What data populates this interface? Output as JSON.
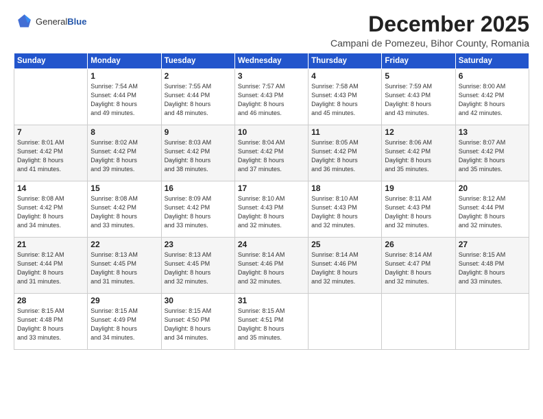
{
  "logo": {
    "general": "General",
    "blue": "Blue"
  },
  "header": {
    "month": "December 2025",
    "location": "Campani de Pomezeu, Bihor County, Romania"
  },
  "weekdays": [
    "Sunday",
    "Monday",
    "Tuesday",
    "Wednesday",
    "Thursday",
    "Friday",
    "Saturday"
  ],
  "weeks": [
    [
      {
        "day": "",
        "info": ""
      },
      {
        "day": "1",
        "info": "Sunrise: 7:54 AM\nSunset: 4:44 PM\nDaylight: 8 hours\nand 49 minutes."
      },
      {
        "day": "2",
        "info": "Sunrise: 7:55 AM\nSunset: 4:44 PM\nDaylight: 8 hours\nand 48 minutes."
      },
      {
        "day": "3",
        "info": "Sunrise: 7:57 AM\nSunset: 4:43 PM\nDaylight: 8 hours\nand 46 minutes."
      },
      {
        "day": "4",
        "info": "Sunrise: 7:58 AM\nSunset: 4:43 PM\nDaylight: 8 hours\nand 45 minutes."
      },
      {
        "day": "5",
        "info": "Sunrise: 7:59 AM\nSunset: 4:43 PM\nDaylight: 8 hours\nand 43 minutes."
      },
      {
        "day": "6",
        "info": "Sunrise: 8:00 AM\nSunset: 4:42 PM\nDaylight: 8 hours\nand 42 minutes."
      }
    ],
    [
      {
        "day": "7",
        "info": "Sunrise: 8:01 AM\nSunset: 4:42 PM\nDaylight: 8 hours\nand 41 minutes."
      },
      {
        "day": "8",
        "info": "Sunrise: 8:02 AM\nSunset: 4:42 PM\nDaylight: 8 hours\nand 39 minutes."
      },
      {
        "day": "9",
        "info": "Sunrise: 8:03 AM\nSunset: 4:42 PM\nDaylight: 8 hours\nand 38 minutes."
      },
      {
        "day": "10",
        "info": "Sunrise: 8:04 AM\nSunset: 4:42 PM\nDaylight: 8 hours\nand 37 minutes."
      },
      {
        "day": "11",
        "info": "Sunrise: 8:05 AM\nSunset: 4:42 PM\nDaylight: 8 hours\nand 36 minutes."
      },
      {
        "day": "12",
        "info": "Sunrise: 8:06 AM\nSunset: 4:42 PM\nDaylight: 8 hours\nand 35 minutes."
      },
      {
        "day": "13",
        "info": "Sunrise: 8:07 AM\nSunset: 4:42 PM\nDaylight: 8 hours\nand 35 minutes."
      }
    ],
    [
      {
        "day": "14",
        "info": "Sunrise: 8:08 AM\nSunset: 4:42 PM\nDaylight: 8 hours\nand 34 minutes."
      },
      {
        "day": "15",
        "info": "Sunrise: 8:08 AM\nSunset: 4:42 PM\nDaylight: 8 hours\nand 33 minutes."
      },
      {
        "day": "16",
        "info": "Sunrise: 8:09 AM\nSunset: 4:42 PM\nDaylight: 8 hours\nand 33 minutes."
      },
      {
        "day": "17",
        "info": "Sunrise: 8:10 AM\nSunset: 4:43 PM\nDaylight: 8 hours\nand 32 minutes."
      },
      {
        "day": "18",
        "info": "Sunrise: 8:10 AM\nSunset: 4:43 PM\nDaylight: 8 hours\nand 32 minutes."
      },
      {
        "day": "19",
        "info": "Sunrise: 8:11 AM\nSunset: 4:43 PM\nDaylight: 8 hours\nand 32 minutes."
      },
      {
        "day": "20",
        "info": "Sunrise: 8:12 AM\nSunset: 4:44 PM\nDaylight: 8 hours\nand 32 minutes."
      }
    ],
    [
      {
        "day": "21",
        "info": "Sunrise: 8:12 AM\nSunset: 4:44 PM\nDaylight: 8 hours\nand 31 minutes."
      },
      {
        "day": "22",
        "info": "Sunrise: 8:13 AM\nSunset: 4:45 PM\nDaylight: 8 hours\nand 31 minutes."
      },
      {
        "day": "23",
        "info": "Sunrise: 8:13 AM\nSunset: 4:45 PM\nDaylight: 8 hours\nand 32 minutes."
      },
      {
        "day": "24",
        "info": "Sunrise: 8:14 AM\nSunset: 4:46 PM\nDaylight: 8 hours\nand 32 minutes."
      },
      {
        "day": "25",
        "info": "Sunrise: 8:14 AM\nSunset: 4:46 PM\nDaylight: 8 hours\nand 32 minutes."
      },
      {
        "day": "26",
        "info": "Sunrise: 8:14 AM\nSunset: 4:47 PM\nDaylight: 8 hours\nand 32 minutes."
      },
      {
        "day": "27",
        "info": "Sunrise: 8:15 AM\nSunset: 4:48 PM\nDaylight: 8 hours\nand 33 minutes."
      }
    ],
    [
      {
        "day": "28",
        "info": "Sunrise: 8:15 AM\nSunset: 4:48 PM\nDaylight: 8 hours\nand 33 minutes."
      },
      {
        "day": "29",
        "info": "Sunrise: 8:15 AM\nSunset: 4:49 PM\nDaylight: 8 hours\nand 34 minutes."
      },
      {
        "day": "30",
        "info": "Sunrise: 8:15 AM\nSunset: 4:50 PM\nDaylight: 8 hours\nand 34 minutes."
      },
      {
        "day": "31",
        "info": "Sunrise: 8:15 AM\nSunset: 4:51 PM\nDaylight: 8 hours\nand 35 minutes."
      },
      {
        "day": "",
        "info": ""
      },
      {
        "day": "",
        "info": ""
      },
      {
        "day": "",
        "info": ""
      }
    ]
  ]
}
